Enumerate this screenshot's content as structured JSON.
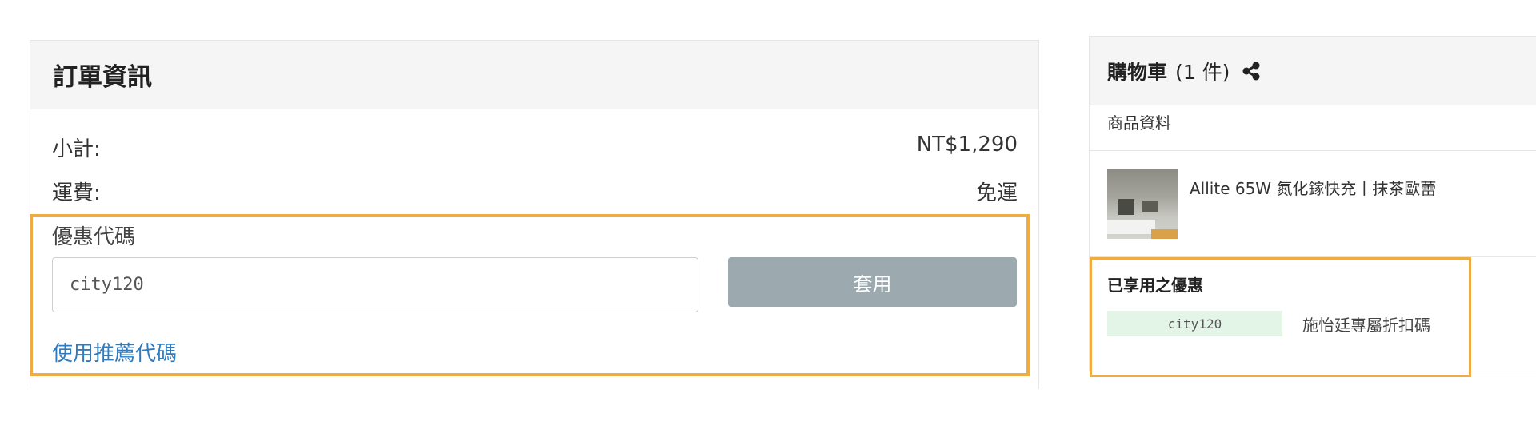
{
  "order": {
    "title": "訂單資訊",
    "subtotal_label": "小計:",
    "subtotal_value": "NT$1,290",
    "shipping_label": "運費:",
    "shipping_value": "免運"
  },
  "coupon": {
    "label": "優惠代碼",
    "input_value": "city120",
    "apply_label": "套用",
    "referral_link": "使用推薦代碼"
  },
  "cart": {
    "title": "購物車",
    "count": "(1 件)",
    "share_icon": "share-icon",
    "product_section_label": "商品資料",
    "product_name": "Allite 65W 氮化鎵快充丨抹茶歐蕾",
    "applied_title": "已享用之優惠",
    "applied_code": "city120",
    "applied_desc": "施怡廷專屬折扣碼"
  },
  "colors": {
    "highlight": "#efac43",
    "apply_button": "#9ca9af",
    "link": "#2e7bbf",
    "code_badge_bg": "#e3f5e6"
  }
}
